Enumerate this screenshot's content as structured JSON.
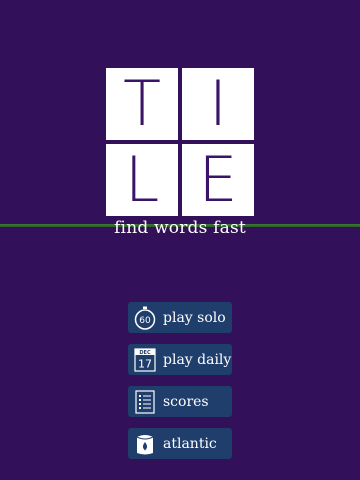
{
  "logo": {
    "tiles": [
      "T",
      "I",
      "L",
      "E"
    ]
  },
  "tagline": "find words fast",
  "menu": {
    "items": [
      {
        "label": "play solo",
        "icon": "stopwatch-icon",
        "icon_text": "60"
      },
      {
        "label": "play daily",
        "icon": "calendar-icon",
        "icon_month": "DEC",
        "icon_day": "17"
      },
      {
        "label": "scores",
        "icon": "scores-list-icon"
      },
      {
        "label": "atlantic",
        "icon": "atlantic-icon"
      }
    ]
  },
  "colors": {
    "background": "#33105a",
    "tile": "#ffffff",
    "tile_letter": "#3a1466",
    "button": "#1f3e6c",
    "accent_line": "#3f7a36"
  }
}
